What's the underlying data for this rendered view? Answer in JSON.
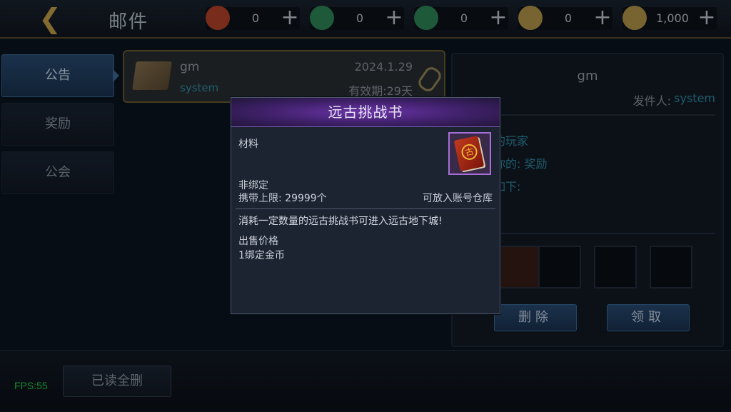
{
  "header": {
    "title": "邮件",
    "currencies": [
      {
        "icon": "scroll-seal-icon",
        "value": "0",
        "color": "#b8442a"
      },
      {
        "icon": "green-crystal-icon",
        "value": "0",
        "color": "#2f8a5a"
      },
      {
        "icon": "green-crystal-bag-icon",
        "value": "0",
        "color": "#2f8a5a"
      },
      {
        "icon": "gold-coin-icon",
        "value": "0",
        "color": "#b89a4a"
      },
      {
        "icon": "bound-gold-coin-icon",
        "value": "1,000",
        "color": "#b89a4a"
      }
    ],
    "plus_label": "+"
  },
  "sidebar": {
    "tabs": [
      {
        "label": "公告",
        "active": true
      },
      {
        "label": "奖励",
        "active": false
      },
      {
        "label": "公会",
        "active": false
      }
    ]
  },
  "mail_list": [
    {
      "sender": "gm",
      "from_tag": "system",
      "date": "2024.1.29",
      "expiry": "有效期:29天"
    }
  ],
  "detail": {
    "sender": "gm",
    "from_label": "发件人:",
    "from_value": "system",
    "body_lines": [
      "的玩家",
      "你的:  奖励",
      "如下:"
    ],
    "delete_label": "删除",
    "claim_label": "领取"
  },
  "bottom": {
    "fps": "FPS:55",
    "delete_read_label": "已读全删"
  },
  "popup": {
    "title": "远古挑战书",
    "item_type": "材料",
    "bind": "非绑定",
    "carry_limit": "携带上限: 29999个",
    "storage": "可放入账号仓库",
    "description": "消耗一定数量的远古挑战书可进入远古地下城!",
    "price_label": "出售价格",
    "price_value": "1绑定金币",
    "icon": "ancient-challenge-book-icon",
    "icon_glyph": "古",
    "rarity_color": "#a66fd8"
  }
}
